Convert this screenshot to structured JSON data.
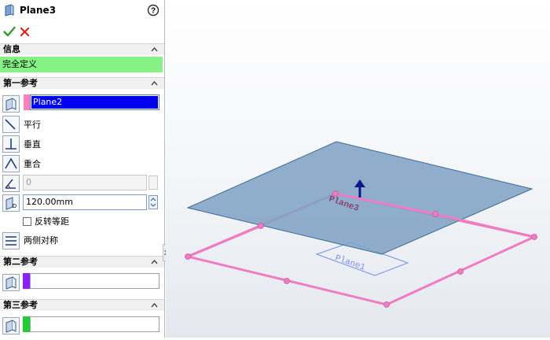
{
  "header": {
    "title": "Plane3",
    "help_icon": "help-circle-icon"
  },
  "actions": {
    "ok_icon": "check-icon",
    "cancel_icon": "close-icon"
  },
  "info": {
    "title": "信息",
    "status": "完全定义",
    "status_color": "#86f286"
  },
  "first_reference": {
    "title": "第一参考",
    "value": "Plane2",
    "swatch_color": "#ff80c0",
    "options": {
      "parallel": "平行",
      "perpendicular": "垂直",
      "coincident": "重合"
    },
    "angle_value": "0",
    "distance_value": "120.00mm",
    "flip_label": "反转等距",
    "flip_checked": false,
    "mid_plane_label": "两侧对称"
  },
  "second_reference": {
    "title": "第二参考",
    "swatch_color": "#8b1fff",
    "value": ""
  },
  "third_reference": {
    "title": "第三参考",
    "swatch_color": "#22cc33",
    "value": ""
  },
  "viewport": {
    "new_plane_label": "Plane3",
    "reference_plane_label": "Plane1",
    "plane_color": "#7fa2c4",
    "preview_color": "#f07dc3"
  }
}
